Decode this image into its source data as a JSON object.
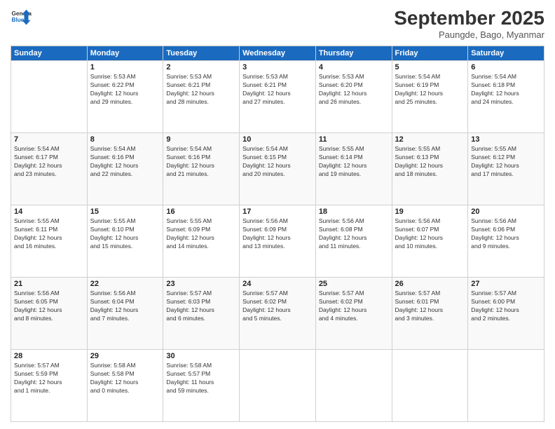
{
  "logo": {
    "general": "General",
    "blue": "Blue"
  },
  "header": {
    "month": "September 2025",
    "location": "Paungde, Bago, Myanmar"
  },
  "days_of_week": [
    "Sunday",
    "Monday",
    "Tuesday",
    "Wednesday",
    "Thursday",
    "Friday",
    "Saturday"
  ],
  "weeks": [
    [
      {
        "day": "",
        "info": ""
      },
      {
        "day": "1",
        "info": "Sunrise: 5:53 AM\nSunset: 6:22 PM\nDaylight: 12 hours\nand 29 minutes."
      },
      {
        "day": "2",
        "info": "Sunrise: 5:53 AM\nSunset: 6:21 PM\nDaylight: 12 hours\nand 28 minutes."
      },
      {
        "day": "3",
        "info": "Sunrise: 5:53 AM\nSunset: 6:21 PM\nDaylight: 12 hours\nand 27 minutes."
      },
      {
        "day": "4",
        "info": "Sunrise: 5:53 AM\nSunset: 6:20 PM\nDaylight: 12 hours\nand 26 minutes."
      },
      {
        "day": "5",
        "info": "Sunrise: 5:54 AM\nSunset: 6:19 PM\nDaylight: 12 hours\nand 25 minutes."
      },
      {
        "day": "6",
        "info": "Sunrise: 5:54 AM\nSunset: 6:18 PM\nDaylight: 12 hours\nand 24 minutes."
      }
    ],
    [
      {
        "day": "7",
        "info": "Sunrise: 5:54 AM\nSunset: 6:17 PM\nDaylight: 12 hours\nand 23 minutes."
      },
      {
        "day": "8",
        "info": "Sunrise: 5:54 AM\nSunset: 6:16 PM\nDaylight: 12 hours\nand 22 minutes."
      },
      {
        "day": "9",
        "info": "Sunrise: 5:54 AM\nSunset: 6:16 PM\nDaylight: 12 hours\nand 21 minutes."
      },
      {
        "day": "10",
        "info": "Sunrise: 5:54 AM\nSunset: 6:15 PM\nDaylight: 12 hours\nand 20 minutes."
      },
      {
        "day": "11",
        "info": "Sunrise: 5:55 AM\nSunset: 6:14 PM\nDaylight: 12 hours\nand 19 minutes."
      },
      {
        "day": "12",
        "info": "Sunrise: 5:55 AM\nSunset: 6:13 PM\nDaylight: 12 hours\nand 18 minutes."
      },
      {
        "day": "13",
        "info": "Sunrise: 5:55 AM\nSunset: 6:12 PM\nDaylight: 12 hours\nand 17 minutes."
      }
    ],
    [
      {
        "day": "14",
        "info": "Sunrise: 5:55 AM\nSunset: 6:11 PM\nDaylight: 12 hours\nand 16 minutes."
      },
      {
        "day": "15",
        "info": "Sunrise: 5:55 AM\nSunset: 6:10 PM\nDaylight: 12 hours\nand 15 minutes."
      },
      {
        "day": "16",
        "info": "Sunrise: 5:55 AM\nSunset: 6:09 PM\nDaylight: 12 hours\nand 14 minutes."
      },
      {
        "day": "17",
        "info": "Sunrise: 5:56 AM\nSunset: 6:09 PM\nDaylight: 12 hours\nand 13 minutes."
      },
      {
        "day": "18",
        "info": "Sunrise: 5:56 AM\nSunset: 6:08 PM\nDaylight: 12 hours\nand 11 minutes."
      },
      {
        "day": "19",
        "info": "Sunrise: 5:56 AM\nSunset: 6:07 PM\nDaylight: 12 hours\nand 10 minutes."
      },
      {
        "day": "20",
        "info": "Sunrise: 5:56 AM\nSunset: 6:06 PM\nDaylight: 12 hours\nand 9 minutes."
      }
    ],
    [
      {
        "day": "21",
        "info": "Sunrise: 5:56 AM\nSunset: 6:05 PM\nDaylight: 12 hours\nand 8 minutes."
      },
      {
        "day": "22",
        "info": "Sunrise: 5:56 AM\nSunset: 6:04 PM\nDaylight: 12 hours\nand 7 minutes."
      },
      {
        "day": "23",
        "info": "Sunrise: 5:57 AM\nSunset: 6:03 PM\nDaylight: 12 hours\nand 6 minutes."
      },
      {
        "day": "24",
        "info": "Sunrise: 5:57 AM\nSunset: 6:02 PM\nDaylight: 12 hours\nand 5 minutes."
      },
      {
        "day": "25",
        "info": "Sunrise: 5:57 AM\nSunset: 6:02 PM\nDaylight: 12 hours\nand 4 minutes."
      },
      {
        "day": "26",
        "info": "Sunrise: 5:57 AM\nSunset: 6:01 PM\nDaylight: 12 hours\nand 3 minutes."
      },
      {
        "day": "27",
        "info": "Sunrise: 5:57 AM\nSunset: 6:00 PM\nDaylight: 12 hours\nand 2 minutes."
      }
    ],
    [
      {
        "day": "28",
        "info": "Sunrise: 5:57 AM\nSunset: 5:59 PM\nDaylight: 12 hours\nand 1 minute."
      },
      {
        "day": "29",
        "info": "Sunrise: 5:58 AM\nSunset: 5:58 PM\nDaylight: 12 hours\nand 0 minutes."
      },
      {
        "day": "30",
        "info": "Sunrise: 5:58 AM\nSunset: 5:57 PM\nDaylight: 11 hours\nand 59 minutes."
      },
      {
        "day": "",
        "info": ""
      },
      {
        "day": "",
        "info": ""
      },
      {
        "day": "",
        "info": ""
      },
      {
        "day": "",
        "info": ""
      }
    ]
  ]
}
